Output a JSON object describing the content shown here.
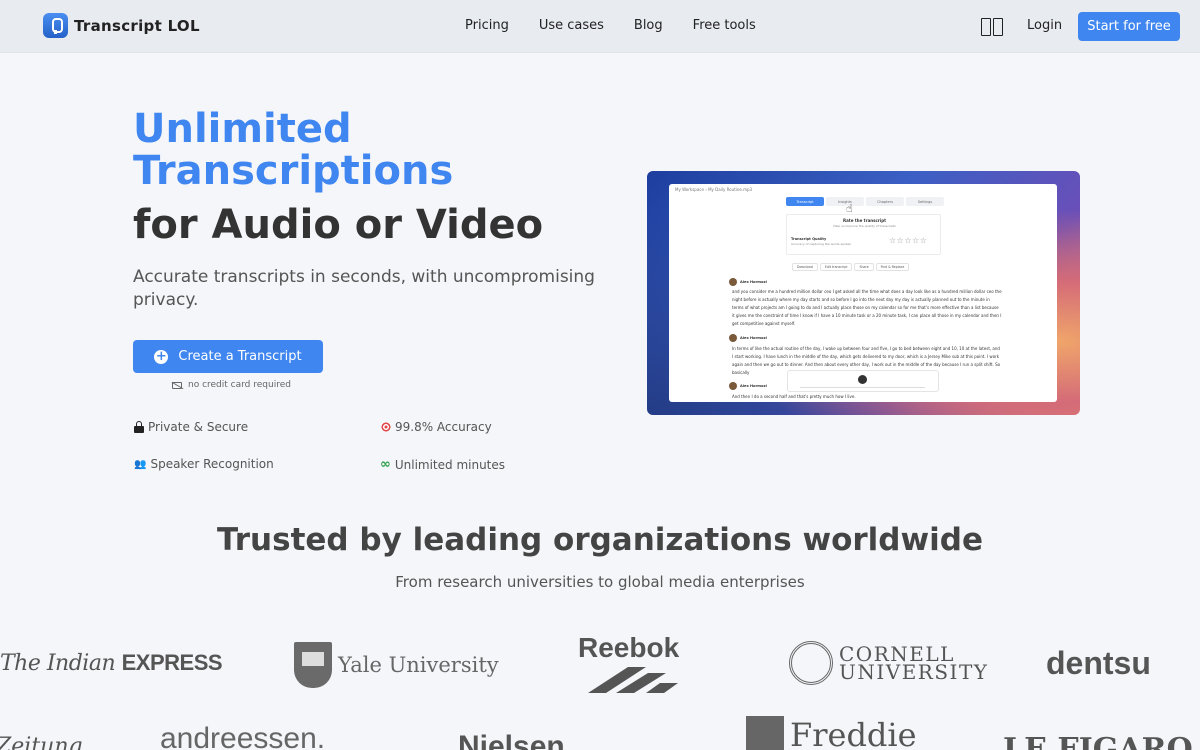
{
  "brand": {
    "name": "Transcript LOL",
    "icon": "microphone-icon"
  },
  "nav": {
    "links": [
      "Pricing",
      "Use cases",
      "Blog",
      "Free tools"
    ],
    "login": "Login",
    "cta": "Start for free"
  },
  "hero": {
    "title_highlight": "Unlimited Transcriptions",
    "title_rest": "for Audio or Video",
    "subtitle": "Accurate transcripts in seconds, with uncompromising privacy.",
    "cta": "Create a Transcript",
    "note": "no credit card required",
    "features": [
      {
        "label": "Private & Secure",
        "icon": "lock-icon"
      },
      {
        "label": "99.8% Accuracy",
        "icon": "target-icon"
      },
      {
        "label": "Speaker Recognition",
        "icon": "people-icon"
      },
      {
        "label": "Unlimited minutes",
        "icon": "infinity-icon"
      }
    ]
  },
  "preview": {
    "breadcrumb": "My Workspace  ›  My Daily Routine.mp3",
    "tabs": [
      "Transcript",
      "Insights",
      "Chapters",
      "Settings"
    ],
    "rating": {
      "title": "Rate the transcript",
      "subtitle": "Help us improve the quality of transcripts",
      "quality_label": "Transcript Quality",
      "quality_sub": "Accuracy of capturing the words spoken"
    },
    "actions": [
      "Download",
      "Edit transcript",
      "Share",
      "Find & Replace"
    ],
    "speaker": "Alex Hormozi",
    "blocks": [
      "and you consider me a hundred million dollar ceo I get asked all the time what does a day look like as a hundred million dollar ceo the night before is actually where my day starts and so before I go into the next day my day is actually planned out to the minute in terms of what projects am I going to do and I actually place those on my calendar so for me that's more effective than a list because it gives me the constraint of time I know if I have a 10 minute task or a 20 minute task, I can place all those in my calendar and then I get competitive against myself.",
      "In terms of like the actual routine of the day, I wake up between four and five, I go to bed between eight and 10, 10 at the latest, and I start working. I have lunch in the middle of the day, which gets delivered to my door, which is a Jersey Mike sub at this point. I work again and then we go out to dinner. And then about every other day, I work out in the middle of the day because I run a split shift. So basically",
      "And then I do a second half and that's pretty much how I live."
    ]
  },
  "trusted": {
    "title": "Trusted by leading organizations worldwide",
    "subtitle": "From research universities to global media enterprises",
    "logos": [
      "The Indian EXPRESS",
      "Yale University",
      "Reebok",
      "CORNELL UNIVERSITY",
      "dentsu",
      "Zeitung",
      "andreessen.",
      "Nielsen",
      "Freddie",
      "LE FIGARO"
    ]
  }
}
